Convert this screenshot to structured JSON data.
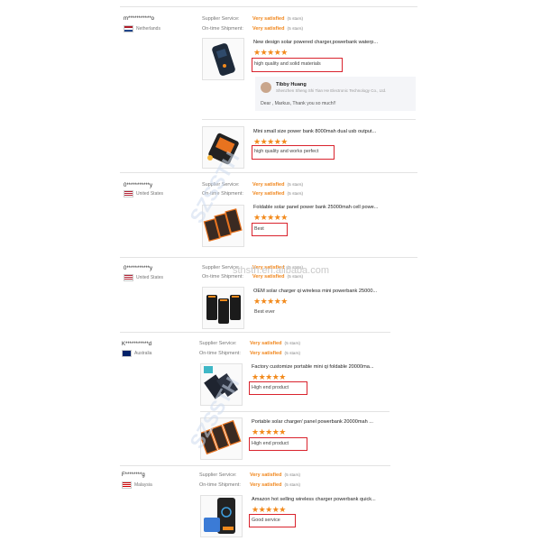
{
  "labels": {
    "supplier_service": "Supplier Service:",
    "ontime_shipment": "On-time Shipment:"
  },
  "reviews": [
    {
      "user": "m***********o",
      "country": "Netherlands",
      "supplier_service": "Very satisfied",
      "supplier_stars": "(5 stars)",
      "ontime_shipment": "Very satisfied",
      "ontime_stars": "(5 stars)",
      "products": [
        {
          "title": "New design solar powered charger,powerbank waterp...",
          "stars": "★★★★★",
          "review": "high quality and solid materials"
        },
        {
          "title": "Mini small size power bank 8000mah dual usb output...",
          "stars": "★★★★★",
          "review": "high quality and works perfect"
        }
      ],
      "reply": {
        "name": "Tibby Huang",
        "company": "Shenzhen Sheng Shi Tian He Electronic Technology Co., Ltd.",
        "text": "Dear , Markus, Thank you so much!!"
      }
    },
    {
      "user": "0***********y",
      "country": "United States",
      "supplier_service": "Very satisfied",
      "supplier_stars": "(5 stars)",
      "ontime_shipment": "Very satisfied",
      "ontime_stars": "(5 stars)",
      "products": [
        {
          "title": "Foldable solar panel power bank 25000mah cell powe...",
          "stars": "★★★★★",
          "review": "Best"
        }
      ]
    },
    {
      "user": "0***********y",
      "country": "United States",
      "supplier_service": "Very satisfied",
      "supplier_stars": "(5 stars)",
      "ontime_shipment": "Very satisfied",
      "ontime_stars": "(5 stars)",
      "products": [
        {
          "title": "OEM solar charger qi wireless mini powerbank 25000...",
          "stars": "★★★★★",
          "review": "Best ever"
        }
      ]
    },
    {
      "user": "K***********d",
      "country": "Australia",
      "supplier_service": "Very satisfied",
      "supplier_stars": "(5 stars)",
      "ontime_shipment": "Very satisfied",
      "ontime_stars": "(5 stars)",
      "products": [
        {
          "title": "Factory customize portable mini qi foldable 20000ma...",
          "stars": "★★★★★",
          "review": "High end product"
        },
        {
          "title": "Portable solar charger/ panel powerbank 20000mah ...",
          "stars": "★★★★★",
          "review": "High end product"
        }
      ]
    },
    {
      "user": "F********g",
      "country": "Malaysia",
      "supplier_service": "Very satisfied",
      "supplier_stars": "(5 stars)",
      "ontime_shipment": "Very satisfied",
      "ontime_stars": "(5 stars)",
      "products": [
        {
          "title": "Amazon hot selling wireless charger powerbank quick...",
          "stars": "★★★★★",
          "review": "Good service"
        }
      ]
    }
  ],
  "watermarks": {
    "brand": "SZSSTH",
    "url": "sthsth.en.alibaba.com"
  },
  "colors": {
    "accent_orange": "#f0851a",
    "star": "#f28a1c",
    "highlight_red": "#d9232d"
  }
}
